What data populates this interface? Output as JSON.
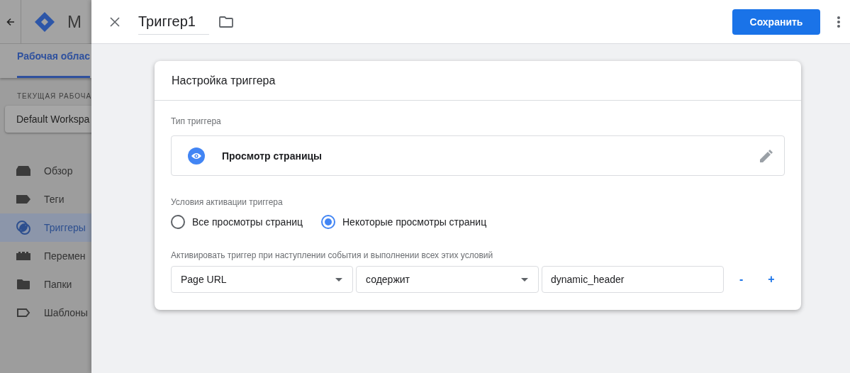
{
  "app": {
    "title": "M",
    "workspace_tab": {
      "label": "Рабочая облас",
      "selected": true
    },
    "section_label": "ТЕКУЩАЯ РАБОЧА",
    "workspace": "Default Workspa",
    "nav": [
      {
        "label": "Обзор",
        "selected": false
      },
      {
        "label": "Теги",
        "selected": false
      },
      {
        "label": "Триггеры",
        "selected": true
      },
      {
        "label": "Перемен",
        "selected": false
      },
      {
        "label": "Папки",
        "selected": false
      },
      {
        "label": "Шаблоны",
        "selected": false
      }
    ]
  },
  "editor": {
    "name": "Триггер1",
    "save": "Сохранить",
    "card_title": "Настройка триггера",
    "trigger_type_label": "Тип триггера",
    "trigger_type": "Просмотр страницы",
    "conditions_label": "Условия активации триггера",
    "options": [
      {
        "label": "Все просмотры страниц",
        "selected": false
      },
      {
        "label": "Некоторые просмотры страниц",
        "selected": true
      }
    ],
    "filter_label": "Активировать триггер при наступлении события и выполнении всех этих условий",
    "filter": {
      "variable": "Page URL",
      "operator": "содержит",
      "value": "dynamic_header",
      "remove": "-",
      "add": "+"
    }
  }
}
